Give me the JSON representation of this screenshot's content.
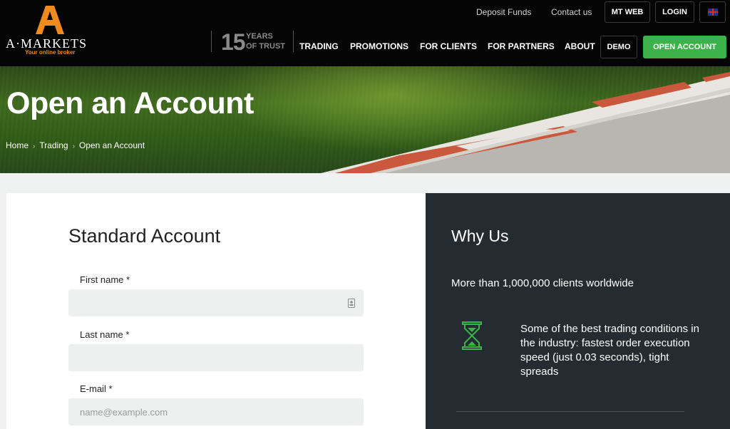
{
  "brand": {
    "name": "A·MARKETS",
    "tagline": "Your online broker",
    "accent_color": "#f08a1c",
    "cta_color": "#3eb24a"
  },
  "header": {
    "top_links": [
      "Deposit Funds",
      "Contact us"
    ],
    "mt_web": "MT WEB",
    "login": "LOGIN",
    "language_icon": "uk-flag-icon",
    "trust_number": "15",
    "trust_line1": "YEARS",
    "trust_line2": "OF TRUST",
    "nav": [
      "TRADING",
      "PROMOTIONS",
      "FOR CLIENTS",
      "FOR PARTNERS",
      "ABOUT"
    ],
    "demo": "DEMO",
    "open_account": "OPEN ACCOUNT"
  },
  "hero": {
    "title": "Open an Account",
    "breadcrumb": [
      "Home",
      "Trading",
      "Open an Account"
    ],
    "separator": "›"
  },
  "form": {
    "title": "Standard Account",
    "fields": [
      {
        "label": "First name *",
        "value": "",
        "placeholder": "",
        "icon": "contact-card-icon"
      },
      {
        "label": "Last name *",
        "value": "",
        "placeholder": ""
      },
      {
        "label": "E-mail *",
        "value": "",
        "placeholder": "name@example.com"
      }
    ]
  },
  "why_us": {
    "title": "Why Us",
    "stat": "More than 1,000,000 clients worldwide",
    "feature_icon": "hourglass-icon",
    "feature_text": "Some of the best trading conditions in the industry: fastest order execution speed (just 0.03 seconds), tight spreads"
  }
}
